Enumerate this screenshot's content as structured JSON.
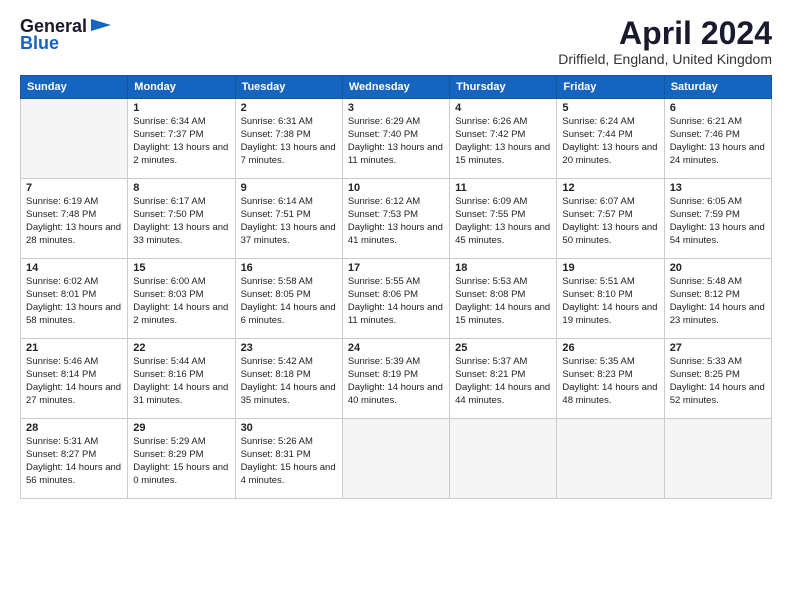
{
  "header": {
    "logo_general": "General",
    "logo_blue": "Blue",
    "title": "April 2024",
    "location": "Driffield, England, United Kingdom"
  },
  "days": [
    "Sunday",
    "Monday",
    "Tuesday",
    "Wednesday",
    "Thursday",
    "Friday",
    "Saturday"
  ],
  "weeks": [
    [
      {
        "day": "",
        "empty": true
      },
      {
        "day": "1",
        "sunrise": "Sunrise: 6:34 AM",
        "sunset": "Sunset: 7:37 PM",
        "daylight": "Daylight: 13 hours and 2 minutes."
      },
      {
        "day": "2",
        "sunrise": "Sunrise: 6:31 AM",
        "sunset": "Sunset: 7:38 PM",
        "daylight": "Daylight: 13 hours and 7 minutes."
      },
      {
        "day": "3",
        "sunrise": "Sunrise: 6:29 AM",
        "sunset": "Sunset: 7:40 PM",
        "daylight": "Daylight: 13 hours and 11 minutes."
      },
      {
        "day": "4",
        "sunrise": "Sunrise: 6:26 AM",
        "sunset": "Sunset: 7:42 PM",
        "daylight": "Daylight: 13 hours and 15 minutes."
      },
      {
        "day": "5",
        "sunrise": "Sunrise: 6:24 AM",
        "sunset": "Sunset: 7:44 PM",
        "daylight": "Daylight: 13 hours and 20 minutes."
      },
      {
        "day": "6",
        "sunrise": "Sunrise: 6:21 AM",
        "sunset": "Sunset: 7:46 PM",
        "daylight": "Daylight: 13 hours and 24 minutes."
      }
    ],
    [
      {
        "day": "7",
        "sunrise": "Sunrise: 6:19 AM",
        "sunset": "Sunset: 7:48 PM",
        "daylight": "Daylight: 13 hours and 28 minutes."
      },
      {
        "day": "8",
        "sunrise": "Sunrise: 6:17 AM",
        "sunset": "Sunset: 7:50 PM",
        "daylight": "Daylight: 13 hours and 33 minutes."
      },
      {
        "day": "9",
        "sunrise": "Sunrise: 6:14 AM",
        "sunset": "Sunset: 7:51 PM",
        "daylight": "Daylight: 13 hours and 37 minutes."
      },
      {
        "day": "10",
        "sunrise": "Sunrise: 6:12 AM",
        "sunset": "Sunset: 7:53 PM",
        "daylight": "Daylight: 13 hours and 41 minutes."
      },
      {
        "day": "11",
        "sunrise": "Sunrise: 6:09 AM",
        "sunset": "Sunset: 7:55 PM",
        "daylight": "Daylight: 13 hours and 45 minutes."
      },
      {
        "day": "12",
        "sunrise": "Sunrise: 6:07 AM",
        "sunset": "Sunset: 7:57 PM",
        "daylight": "Daylight: 13 hours and 50 minutes."
      },
      {
        "day": "13",
        "sunrise": "Sunrise: 6:05 AM",
        "sunset": "Sunset: 7:59 PM",
        "daylight": "Daylight: 13 hours and 54 minutes."
      }
    ],
    [
      {
        "day": "14",
        "sunrise": "Sunrise: 6:02 AM",
        "sunset": "Sunset: 8:01 PM",
        "daylight": "Daylight: 13 hours and 58 minutes."
      },
      {
        "day": "15",
        "sunrise": "Sunrise: 6:00 AM",
        "sunset": "Sunset: 8:03 PM",
        "daylight": "Daylight: 14 hours and 2 minutes."
      },
      {
        "day": "16",
        "sunrise": "Sunrise: 5:58 AM",
        "sunset": "Sunset: 8:05 PM",
        "daylight": "Daylight: 14 hours and 6 minutes."
      },
      {
        "day": "17",
        "sunrise": "Sunrise: 5:55 AM",
        "sunset": "Sunset: 8:06 PM",
        "daylight": "Daylight: 14 hours and 11 minutes."
      },
      {
        "day": "18",
        "sunrise": "Sunrise: 5:53 AM",
        "sunset": "Sunset: 8:08 PM",
        "daylight": "Daylight: 14 hours and 15 minutes."
      },
      {
        "day": "19",
        "sunrise": "Sunrise: 5:51 AM",
        "sunset": "Sunset: 8:10 PM",
        "daylight": "Daylight: 14 hours and 19 minutes."
      },
      {
        "day": "20",
        "sunrise": "Sunrise: 5:48 AM",
        "sunset": "Sunset: 8:12 PM",
        "daylight": "Daylight: 14 hours and 23 minutes."
      }
    ],
    [
      {
        "day": "21",
        "sunrise": "Sunrise: 5:46 AM",
        "sunset": "Sunset: 8:14 PM",
        "daylight": "Daylight: 14 hours and 27 minutes."
      },
      {
        "day": "22",
        "sunrise": "Sunrise: 5:44 AM",
        "sunset": "Sunset: 8:16 PM",
        "daylight": "Daylight: 14 hours and 31 minutes."
      },
      {
        "day": "23",
        "sunrise": "Sunrise: 5:42 AM",
        "sunset": "Sunset: 8:18 PM",
        "daylight": "Daylight: 14 hours and 35 minutes."
      },
      {
        "day": "24",
        "sunrise": "Sunrise: 5:39 AM",
        "sunset": "Sunset: 8:19 PM",
        "daylight": "Daylight: 14 hours and 40 minutes."
      },
      {
        "day": "25",
        "sunrise": "Sunrise: 5:37 AM",
        "sunset": "Sunset: 8:21 PM",
        "daylight": "Daylight: 14 hours and 44 minutes."
      },
      {
        "day": "26",
        "sunrise": "Sunrise: 5:35 AM",
        "sunset": "Sunset: 8:23 PM",
        "daylight": "Daylight: 14 hours and 48 minutes."
      },
      {
        "day": "27",
        "sunrise": "Sunrise: 5:33 AM",
        "sunset": "Sunset: 8:25 PM",
        "daylight": "Daylight: 14 hours and 52 minutes."
      }
    ],
    [
      {
        "day": "28",
        "sunrise": "Sunrise: 5:31 AM",
        "sunset": "Sunset: 8:27 PM",
        "daylight": "Daylight: 14 hours and 56 minutes."
      },
      {
        "day": "29",
        "sunrise": "Sunrise: 5:29 AM",
        "sunset": "Sunset: 8:29 PM",
        "daylight": "Daylight: 15 hours and 0 minutes."
      },
      {
        "day": "30",
        "sunrise": "Sunrise: 5:26 AM",
        "sunset": "Sunset: 8:31 PM",
        "daylight": "Daylight: 15 hours and 4 minutes."
      },
      {
        "day": "",
        "empty": true
      },
      {
        "day": "",
        "empty": true
      },
      {
        "day": "",
        "empty": true
      },
      {
        "day": "",
        "empty": true
      }
    ]
  ]
}
